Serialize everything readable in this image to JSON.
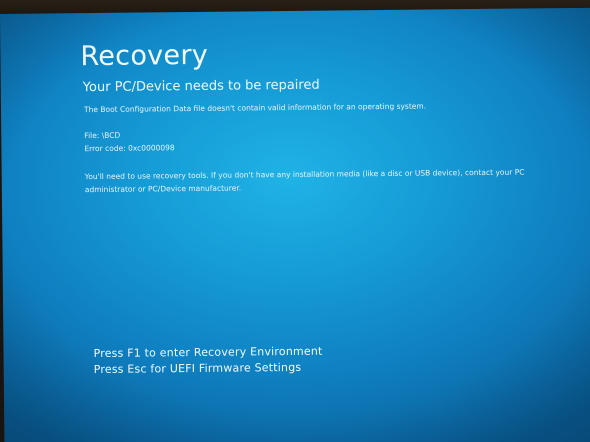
{
  "screen": {
    "title": "Recovery",
    "subtitle": "Your PC/Device needs to be repaired",
    "description": "The Boot Configuration Data file doesn't contain valid information for an operating system.",
    "file_line": "File: \\BCD",
    "error_code_line": "Error code: 0xc0000098",
    "instructions": "You'll need to use recovery tools. If you don't have any installation media (like a disc or USB device), contact your PC administrator or PC/Device manufacturer."
  },
  "key_options": [
    {
      "label": "Press F1 to enter Recovery Environment"
    },
    {
      "label": "Press Esc for UEFI Firmware Settings"
    }
  ],
  "colors": {
    "background_blue": "#1599d4",
    "text": "#ffffff",
    "bezel": "#1c1812"
  }
}
